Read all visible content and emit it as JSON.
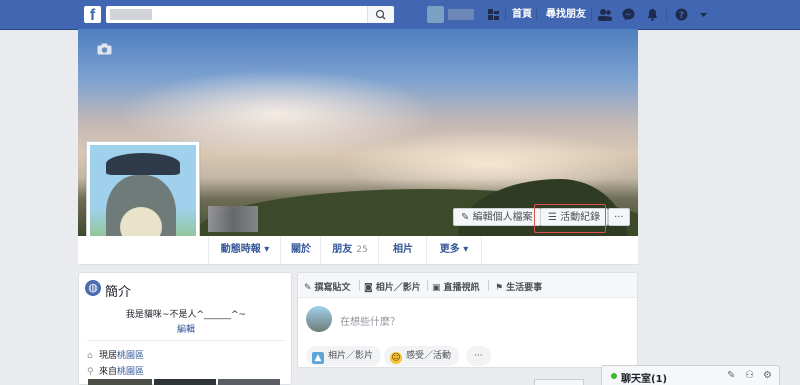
{
  "topbar": {
    "logo": "f",
    "search_placeholder": "",
    "nav_home": "首頁",
    "nav_find_friends": "尋找朋友"
  },
  "cover": {
    "edit_profile": "編輯個人檔案",
    "activity_log": "活動紀錄",
    "more_dots": "···"
  },
  "profile_nav": {
    "timeline": "動態時報 ▾",
    "about": "關於",
    "friends": "朋友",
    "friends_count": "25",
    "photos": "相片",
    "more": "更多 ▾"
  },
  "intro": {
    "title": "簡介",
    "bio": "我是貓咪~不是人^______^~",
    "edit": "編輯",
    "current_city_prefix": "現居",
    "current_city": "桃園區",
    "hometown_prefix": "來自",
    "hometown": "桃園區"
  },
  "composer": {
    "tabs": [
      "撰寫貼文",
      "相片／影片",
      "直播視訊",
      "生活要事"
    ],
    "placeholder": "在想些什麼？",
    "photo_video": "相片／影片",
    "feeling": "感受／活動",
    "more": "···"
  },
  "chat": {
    "label": "聊天室(1)"
  },
  "colors": {
    "brand": "#4267b2",
    "link": "#365899",
    "highlight": "#e0514f"
  }
}
